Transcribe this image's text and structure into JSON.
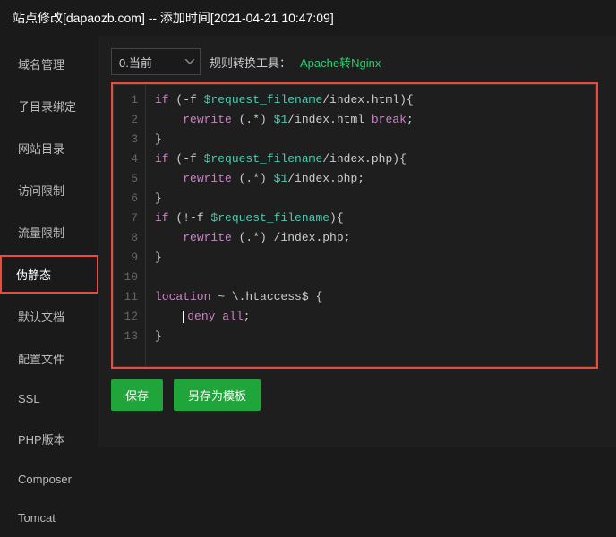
{
  "header": {
    "title": "站点修改[dapaozb.com] -- 添加时间[2021-04-21 10:47:09]"
  },
  "sidebar": {
    "items": [
      {
        "label": "域名管理"
      },
      {
        "label": "子目录绑定"
      },
      {
        "label": "网站目录"
      },
      {
        "label": "访问限制"
      },
      {
        "label": "流量限制"
      },
      {
        "label": "伪静态"
      },
      {
        "label": "默认文档"
      },
      {
        "label": "配置文件"
      },
      {
        "label": "SSL"
      },
      {
        "label": "PHP版本"
      },
      {
        "label": "Composer"
      },
      {
        "label": "Tomcat"
      }
    ],
    "active_index": 5
  },
  "toolbar": {
    "select_value": "0.当前",
    "converter_label": "规则转换工具：",
    "converter_link": "Apache转Nginx"
  },
  "editor": {
    "lines": [
      "if (-f $request_filename/index.html){",
      "    rewrite (.*) $1/index.html break;",
      "}",
      "if (-f $request_filename/index.php){",
      "    rewrite (.*) $1/index.php;",
      "}",
      "if (!-f $request_filename){",
      "    rewrite (.*) /index.php;",
      "}",
      "",
      "location ~ \\.htaccess$ {",
      "    deny all;",
      "}"
    ]
  },
  "actions": {
    "save": "保存",
    "save_template": "另存为模板"
  }
}
